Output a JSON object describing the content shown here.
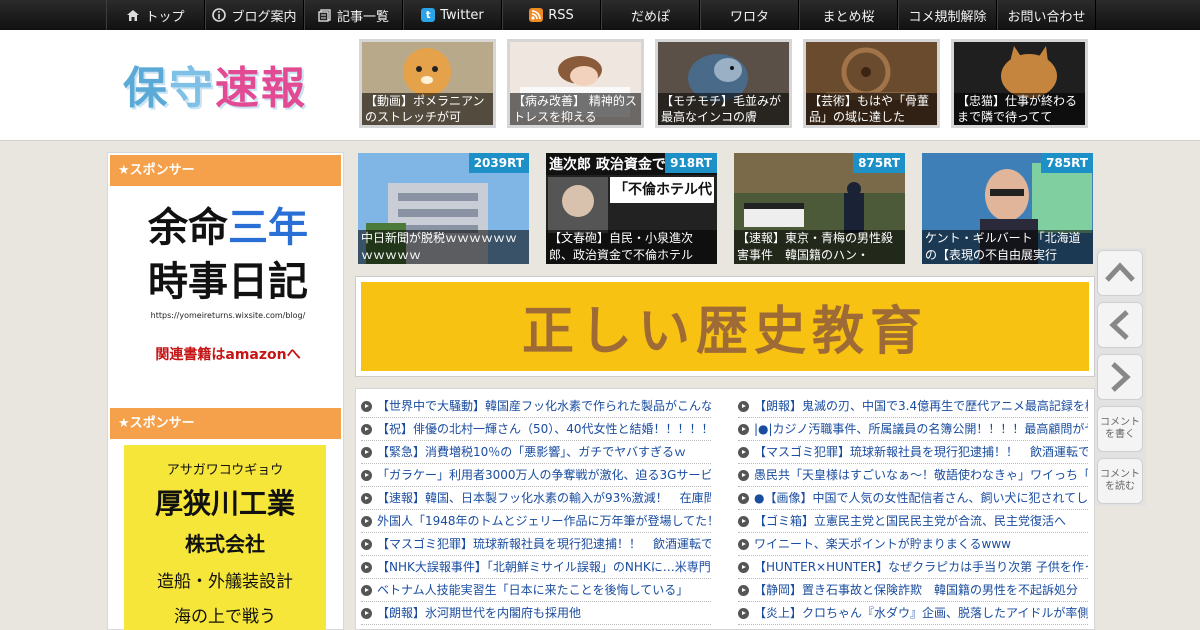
{
  "nav": {
    "items": [
      {
        "label": "トップ",
        "icon": "home-icon"
      },
      {
        "label": "ブログ案内",
        "icon": "info-icon"
      },
      {
        "label": "記事一覧",
        "icon": "list-icon"
      },
      {
        "label": "Twitter",
        "icon": "twitter-icon"
      },
      {
        "label": "RSS",
        "icon": "rss-icon"
      },
      {
        "label": "だめぽ",
        "icon": ""
      },
      {
        "label": "ワロタ",
        "icon": ""
      },
      {
        "label": "まとめ桜",
        "icon": ""
      },
      {
        "label": "コメ規制解除",
        "icon": ""
      },
      {
        "label": "お問い合わせ",
        "icon": ""
      }
    ]
  },
  "header": {
    "logo": {
      "c1": "保",
      "c2": "守",
      "c3": "速",
      "c4": "報"
    },
    "thumbs": [
      "【動画】ポメラニアンのストレッチが可",
      "【病み改善】 精神的ストレスを抑える",
      "【モチモチ】毛並みが最高なインコの膚",
      "【芸術】もはや「骨董品」の域に達した",
      "【忠猫】仕事が終わるまで隣で待ってて"
    ]
  },
  "sidebar": {
    "sponsor_label_1": "★スポンサー",
    "sponsor_label_2": "★スポンサー",
    "ad1": {
      "line1a": "余命",
      "line1b": "三年",
      "line2": "時事日記",
      "url": "https://yomeireturns.wixsite.com/blog/",
      "amazon": "関連書籍はamazonへ"
    },
    "ad2": {
      "kana": "アサガワコウギョウ",
      "name": "厚狭川工業",
      "kk": "株式会社",
      "biz": "造船・外艤装設計",
      "more": "海の上で戦う"
    }
  },
  "rt_thumbs": [
    {
      "badge": "2039RT",
      "caption": "中日新聞が脱税ｗｗｗｗｗｗｗｗｗｗｗ"
    },
    {
      "badge": "918RT",
      "caption": "【文春砲】自民・小泉進次郎、政治資金で不倫ホテル"
    },
    {
      "badge": "875RT",
      "caption": "【速報】東京・青梅の男性殺害事件　韓国籍のハン・"
    },
    {
      "badge": "785RT",
      "caption": "ケント・ギルバート「北海道の【表現の不自由展実行"
    }
  ],
  "rt_images": {
    "img2_text1": "進次郎 政治資金で",
    "img2_text2": "「不倫ホテル代"
  },
  "banner": {
    "text": "正しい歴史教育"
  },
  "list": {
    "left": [
      "【世界中で大騒動】韓国産フッ化水素で作られた製品がこんな",
      "【祝】俳優の北村一輝さん（50）、40代女性と結婚！！！！！",
      "【緊急】消費増税10％の「悪影響」、ガチでヤバすぎるｗ",
      "「ガラケー」利用者3000万人の争奪戦が激化、迫る3Gサービス",
      "【速報】韓国、日本製フッ化水素の輸入が93%激減！　在庫問",
      "外国人「1948年のトムとジェリー作品に万年筆が登場してた！",
      "【マスゴミ犯罪】琉球新報社員を現行犯逮捕！！　飲酒運転で",
      "【NHK大誤報事件】「北朝鮮ミサイル誤報」のNHKに…米専門",
      "ベトナム人技能実習生「日本に来たことを後悔している」",
      "【朗報】氷河期世代を内閣府も採用他"
    ],
    "right": [
      "【朗報】鬼滅の刃、中国で3.4億再生で歴代アニメ最高記録を樹",
      "|●|カジノ汚職事件、所属議員の名簿公開！！！！最高顧問がヤ",
      "【マスゴミ犯罪】琉球新報社員を現行犯逮捕！！　飲酒運転で",
      "愚民共「天皇様はすごいなぁ～！敬語使わなきゃ」ワイっち「",
      "●【画像】中国で人気の女性配信者さん、飼い犬に犯されてし",
      "【ゴミ箱】立憲民主党と国民民主党が合流、民主党復活へ",
      "ワイニート、楽天ポイントが貯まりまくるwww",
      "【HUNTER×HUNTER】なぜクラピカは手当り次第 子供を作っ",
      "【静岡】置き石事故と保険詐欺　韓国籍の男性を不起訴処分",
      "【炎上】クロちゃん『水ダウ』企画、脱落したアイドルが率側"
    ]
  },
  "side_buttons": {
    "comment_write": "コメントを書く",
    "comment_read": "コメントを読む"
  }
}
